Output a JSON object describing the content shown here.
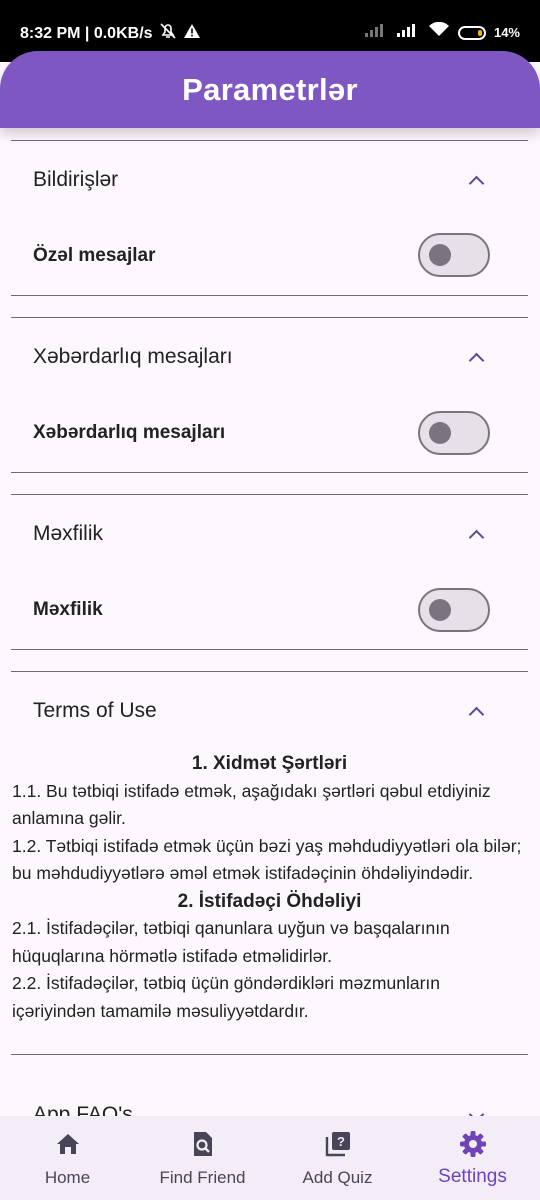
{
  "status_bar": {
    "time": "8:32 PM | 0.0KB/s",
    "battery": "14%"
  },
  "app_bar": {
    "title": "Parametrlər"
  },
  "sections": [
    {
      "header": "Bildirişlər",
      "row_label": "Özəl mesajlar",
      "toggle_on": false
    },
    {
      "header": "Xəbərdarlıq mesajları",
      "row_label": "Xəbərdarlıq mesajları",
      "toggle_on": false
    },
    {
      "header": "Məxfilik",
      "row_label": "Məxfilik",
      "toggle_on": false
    }
  ],
  "terms": {
    "header": "Terms of Use",
    "h1": "1. Xidmət Şərtləri",
    "p1": "1.1. Bu tətbiqi istifadə etmək, aşağıdakı şərtləri qəbul etdiyiniz anlamına gəlir.",
    "p2": "1.2. Tətbiqi istifadə etmək üçün bəzi yaş məhdudiyyətləri ola bilər; bu məhdudiyyətlərə əməl etmək istifadəçinin öhdəliyindədir.",
    "h2": "2. İstifadəçi Öhdəliyi",
    "p3": "2.1. İstifadəçilər, tətbiqi qanunlara uyğun və başqalarının hüquqlarına hörmətlə istifadə etməlidirlər.",
    "p4": "2.2. İstifadəçilər, tətbiq üçün göndərdikləri məzmunların içəriyindən tamamilə məsuliyyətdardır."
  },
  "faq": {
    "header": "App FAQ's"
  },
  "bottom_nav": [
    {
      "label": "Home",
      "icon": "home-icon"
    },
    {
      "label": "Find Friend",
      "icon": "find-friend-icon"
    },
    {
      "label": "Add Quiz",
      "icon": "add-quiz-icon"
    },
    {
      "label": "Settings",
      "icon": "settings-icon",
      "active": true
    }
  ],
  "colors": {
    "primary": "#7e57c2",
    "active_nav": "#6e44b8",
    "background": "#fdf8fe",
    "nav_background": "#f3edf7"
  }
}
